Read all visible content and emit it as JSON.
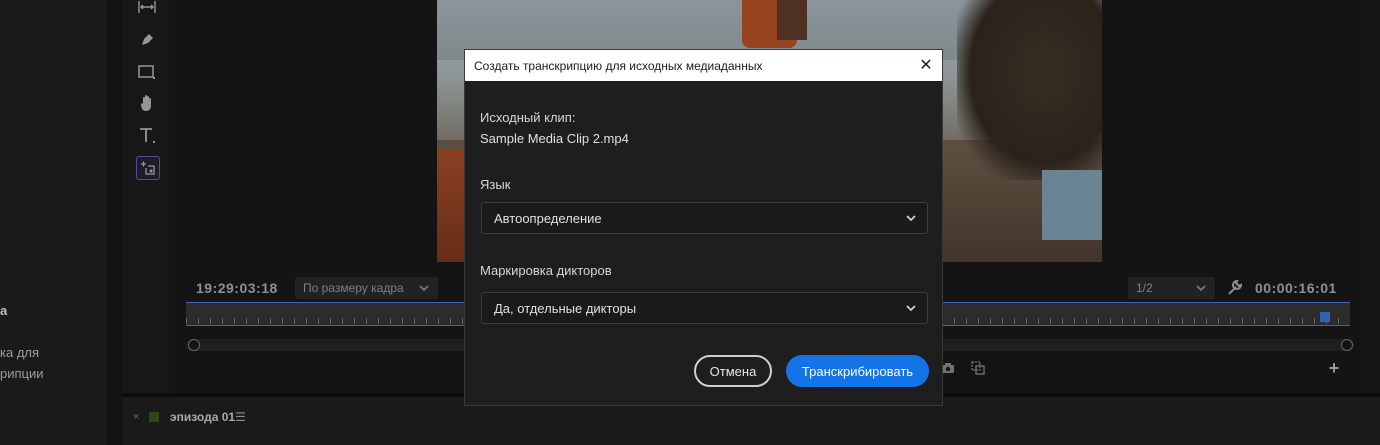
{
  "left_panel": {
    "heading": "а",
    "desc_line1": "ка для",
    "desc_line2": "рипции"
  },
  "monitor": {
    "timecode_current": "19:29:03:18",
    "timecode_duration": "00:00:16:01",
    "fit_dropdown": {
      "value": "По размеру кадра"
    },
    "resolution_dropdown": {
      "value": "1/2"
    }
  },
  "timeline": {
    "sequence_name": "эпизода 01",
    "menu_glyph": "☰",
    "close_glyph": "×",
    "swatch_color": "#3f5f1d"
  },
  "dialog": {
    "title": "Создать транскрипцию для исходных медиаданных",
    "close_glyph": "✕",
    "source_clip_label": "Исходный клип:",
    "source_clip_value": "Sample Media Clip 2.mp4",
    "language_label": "Язык",
    "language_value": "Автоопределение",
    "speaker_label": "Маркировка дикторов",
    "speaker_value": "Да, отдельные дикторы",
    "cancel_label": "Отмена",
    "transcribe_label": "Транскрибировать",
    "accent_color": "#1473e6"
  },
  "icons": {
    "tools": [
      "track-select-icon",
      "pen-icon",
      "rectangle-icon",
      "hand-icon",
      "type-icon",
      "auto-reframe-icon"
    ],
    "controls": [
      "camera-icon",
      "compare-icon",
      "add-icon",
      "wrench-icon",
      "chevron-down-icon"
    ]
  }
}
